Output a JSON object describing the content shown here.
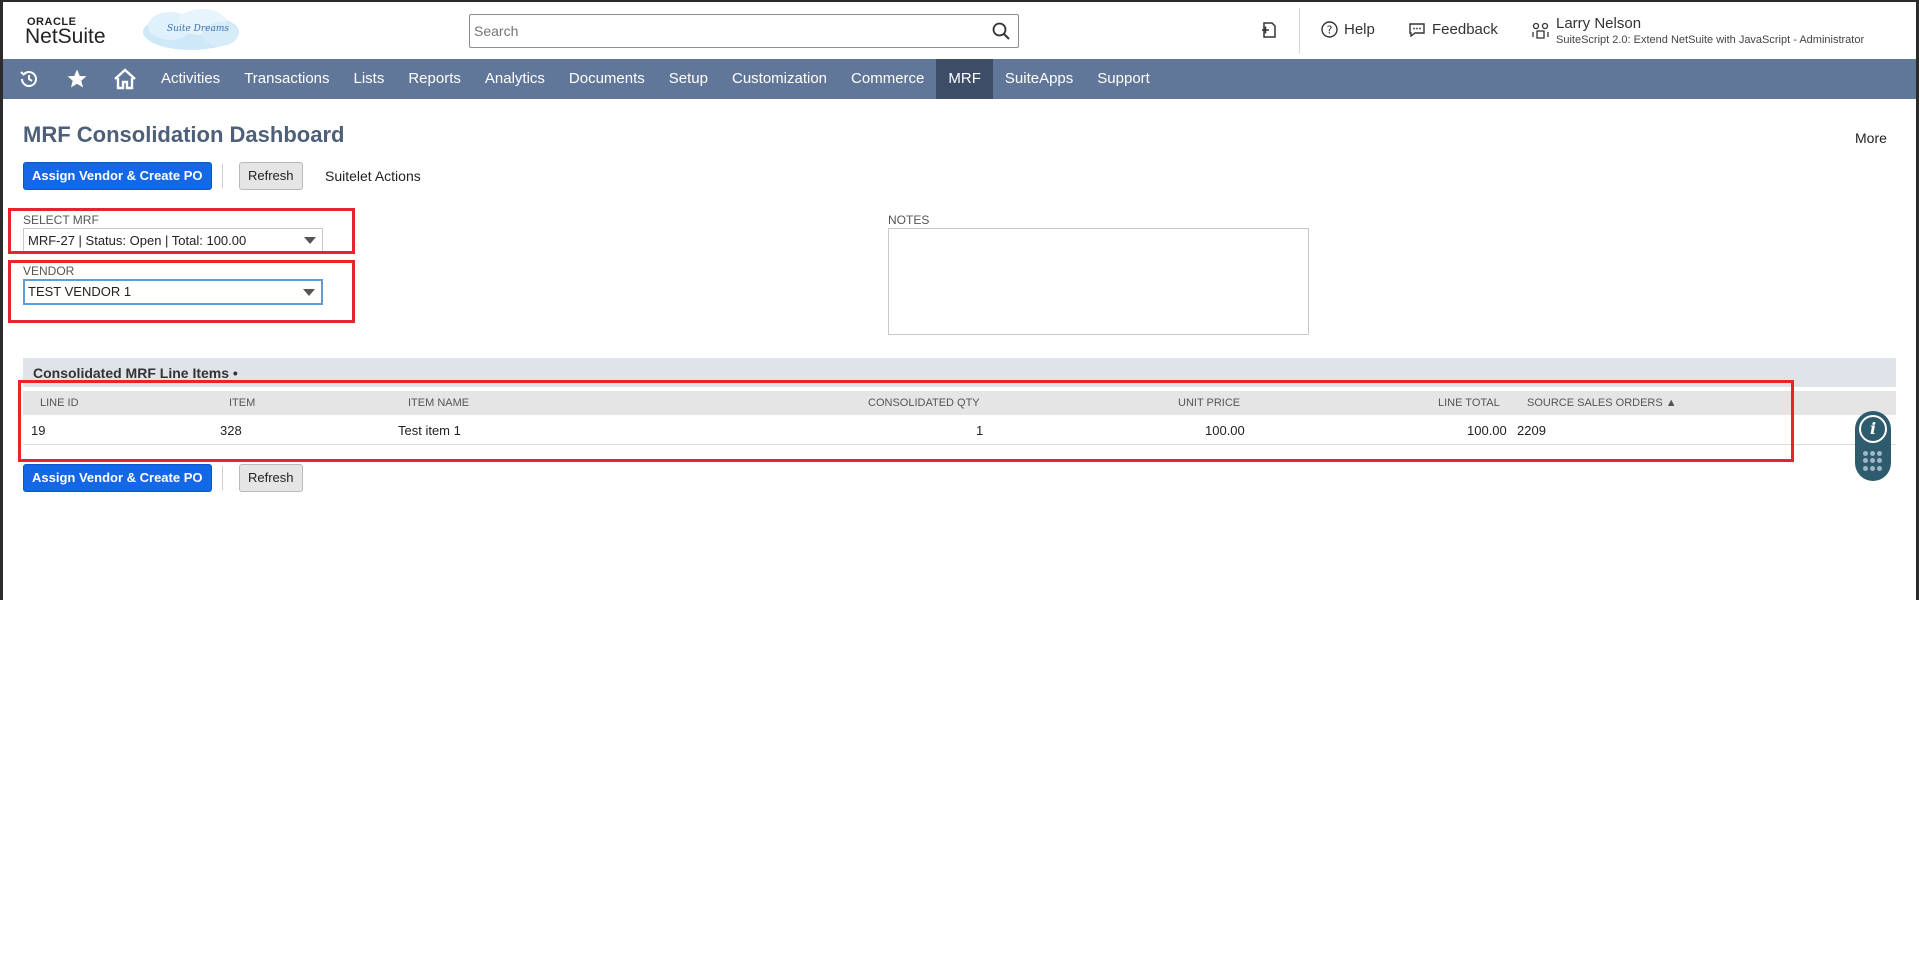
{
  "header": {
    "logo_oracle": "ORACLE",
    "logo_netsuite": "NetSuite",
    "cloud_label": "Suite Dreams",
    "search_placeholder": "Search",
    "help_label": "Help",
    "feedback_label": "Feedback",
    "user_name": "Larry Nelson",
    "user_role": "SuiteScript 2.0: Extend NetSuite with JavaScript - Administrator"
  },
  "nav": {
    "items": [
      {
        "label": "Activities"
      },
      {
        "label": "Transactions"
      },
      {
        "label": "Lists"
      },
      {
        "label": "Reports"
      },
      {
        "label": "Analytics"
      },
      {
        "label": "Documents"
      },
      {
        "label": "Setup"
      },
      {
        "label": "Customization"
      },
      {
        "label": "Commerce"
      },
      {
        "label": "MRF"
      },
      {
        "label": "SuiteApps"
      },
      {
        "label": "Support"
      }
    ],
    "active": "MRF"
  },
  "page": {
    "title": "MRF Consolidation Dashboard",
    "more_label": "More",
    "assign_button": "Assign Vendor & Create PO",
    "refresh_button": "Refresh",
    "suitelet_actions": "Suitelet Actions"
  },
  "form": {
    "select_mrf_label": "SELECT MRF",
    "select_mrf_value": "MRF-27 | Status: Open | Total: 100.00",
    "vendor_label": "VENDOR",
    "vendor_value": "TEST VENDOR 1",
    "notes_label": "NOTES",
    "notes_value": ""
  },
  "sublist": {
    "title": "Consolidated MRF Line Items •",
    "columns": [
      "LINE ID",
      "ITEM",
      "ITEM NAME",
      "CONSOLIDATED QTY",
      "UNIT PRICE",
      "LINE TOTAL",
      "SOURCE SALES ORDERS ▲"
    ],
    "rows": [
      {
        "line_id": "19",
        "item": "328",
        "item_name": "Test item 1",
        "qty": "1",
        "unit_price": "100.00",
        "line_total": "100.00",
        "source_orders": "2209"
      }
    ]
  },
  "colors": {
    "nav_bg": "#607799",
    "nav_active": "#3d4d67",
    "primary_button": "#1467e6",
    "title_color": "#4d5f79",
    "highlight_red": "#e8232a"
  }
}
